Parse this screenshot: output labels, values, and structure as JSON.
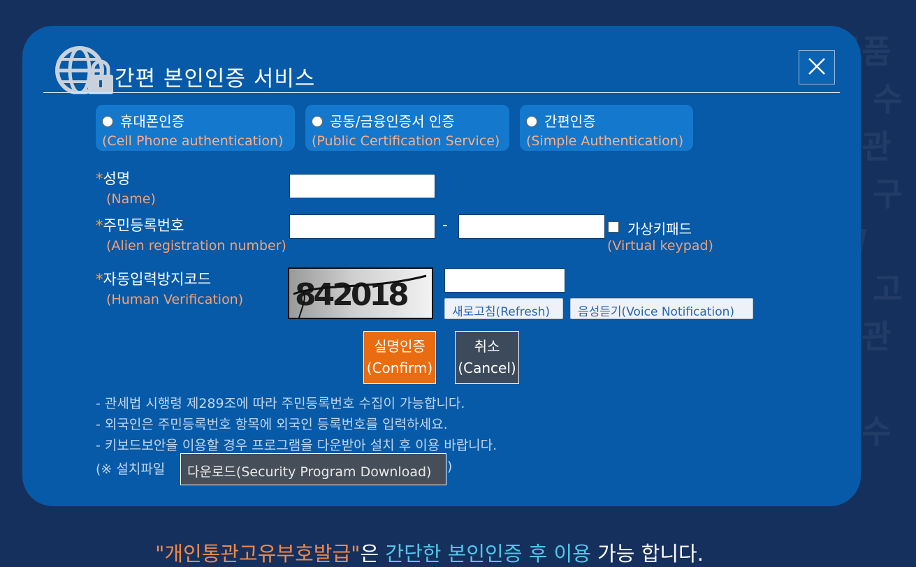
{
  "dialog": {
    "title": "간편 본인인증 서비스",
    "close_icon": "close-icon",
    "header_icon": "globe-lock-icon"
  },
  "tabs": [
    {
      "ko": "휴대폰인증",
      "en": "(Cell Phone authentication)"
    },
    {
      "ko": "공동/금융인증서 인증",
      "en": "(Public Certification Service)"
    },
    {
      "ko": "간편인증",
      "en": "(Simple Authentication)"
    }
  ],
  "form": {
    "required_mark": "*",
    "name": {
      "ko": "성명",
      "en": "(Name)",
      "value": ""
    },
    "registration": {
      "ko": "주민등록번호",
      "en": "(Alien registration number)",
      "separator": "-",
      "value_front": "",
      "value_back": ""
    },
    "virtual_keypad": {
      "ko": "가상키패드",
      "en": "(Virtual keypad)",
      "checked": false
    },
    "human_verification": {
      "ko": "자동입력방지코드",
      "en": "(Human Verification)",
      "captcha_text": "842018",
      "value": "",
      "refresh_label": "새로고침(Refresh)",
      "voice_label": "음성듣기(Voice Notification)"
    }
  },
  "actions": {
    "confirm_ko": "실명인증",
    "confirm_en": "(Confirm)",
    "cancel_ko": "취소",
    "cancel_en": "(Cancel)"
  },
  "notes": [
    "- 관세법 시행령 제289조에 따라 주민등록번호 수집이 가능합니다.",
    "- 외국인은 주민등록번호 항목에 외국인 등록번호를 입력하세요.",
    "- 키보드보안을 이용할 경우 프로그램을 다운받아 설치 후 이용 바랍니다."
  ],
  "download": {
    "prefix": "(※ 설치파일",
    "button_label": "다운로드(Security Program Download)",
    "suffix": ")"
  },
  "footer": {
    "part1": "\"개인통관고유부호발급\"",
    "part2": "은 ",
    "part3": "간단한 본인인증 후 이용",
    "part4": " 가능 합니다."
  },
  "colors": {
    "page_bg": "#16305e",
    "dialog_bg": "#075aa7",
    "tab_bg": "#1478cd",
    "accent_orange": "#ea6c10",
    "cancel_bg": "#3d4a5c",
    "label_en": "#f7a071",
    "footer_cyan": "#4fc8ea"
  }
}
